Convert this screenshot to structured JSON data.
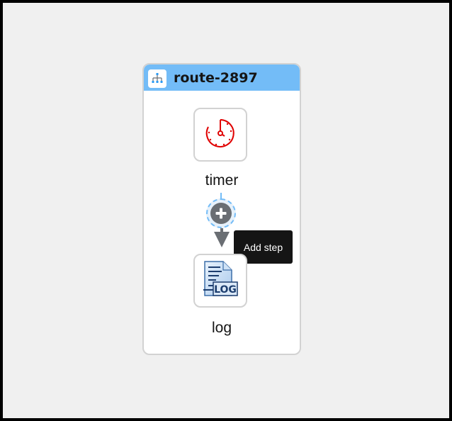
{
  "route": {
    "title": "route-2897",
    "header_color": "#73bcf7",
    "icon": "route-hierarchy-icon"
  },
  "steps": [
    {
      "label": "timer",
      "icon": "timer-clock-icon",
      "icon_color": "#e00000"
    },
    {
      "label": "log",
      "icon": "log-document-icon",
      "icon_text": "LOG"
    }
  ],
  "add_step": {
    "icon": "plus-circle-icon",
    "tooltip": "Add step"
  }
}
